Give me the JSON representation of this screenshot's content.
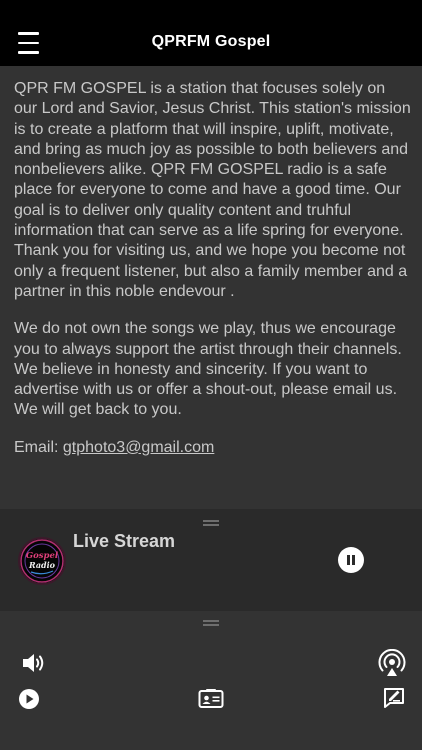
{
  "header": {
    "title": "QPRFM Gospel",
    "menu_icon": "hamburger-menu-icon"
  },
  "content": {
    "paragraph1": "QPR FM GOSPEL is a station that focuses solely on our Lord and Savior, Jesus Christ. This station's mission is to create a platform that will inspire, uplift, motivate, and bring as much joy as possible to both believers and nonbelievers alike. QPR FM GOSPEL radio is a safe place for everyone to come and have a good time. Our goal is to deliver only quality content and truhful information that can serve as a life spring for everyone. Thank you for visiting us, and we hope you become not only a frequent listener, but also a family member and a partner in this noble endevour .",
    "paragraph2": "We do not own the songs we play, thus we encourage you to always support the artist through their channels. We believe in honesty and sincerity. If you want to advertise with us or offer a shout-out, please email us. We will get back to you.",
    "email_label": "Email: ",
    "email": "gtphoto3@gmail.com"
  },
  "player": {
    "title": "Live Stream",
    "logo_text_top": "Gospel",
    "logo_text_bottom": "Radio",
    "state_icon": "pause-icon"
  },
  "controls": {
    "icons": [
      "volume-icon",
      "airplay-icon",
      "play-icon",
      "contact-card-icon",
      "compose-icon"
    ]
  },
  "colors": {
    "header_bg": "#000000",
    "page_bg": "#333333",
    "player_bg": "#2a2a2a",
    "text": "#c8c8c8"
  }
}
